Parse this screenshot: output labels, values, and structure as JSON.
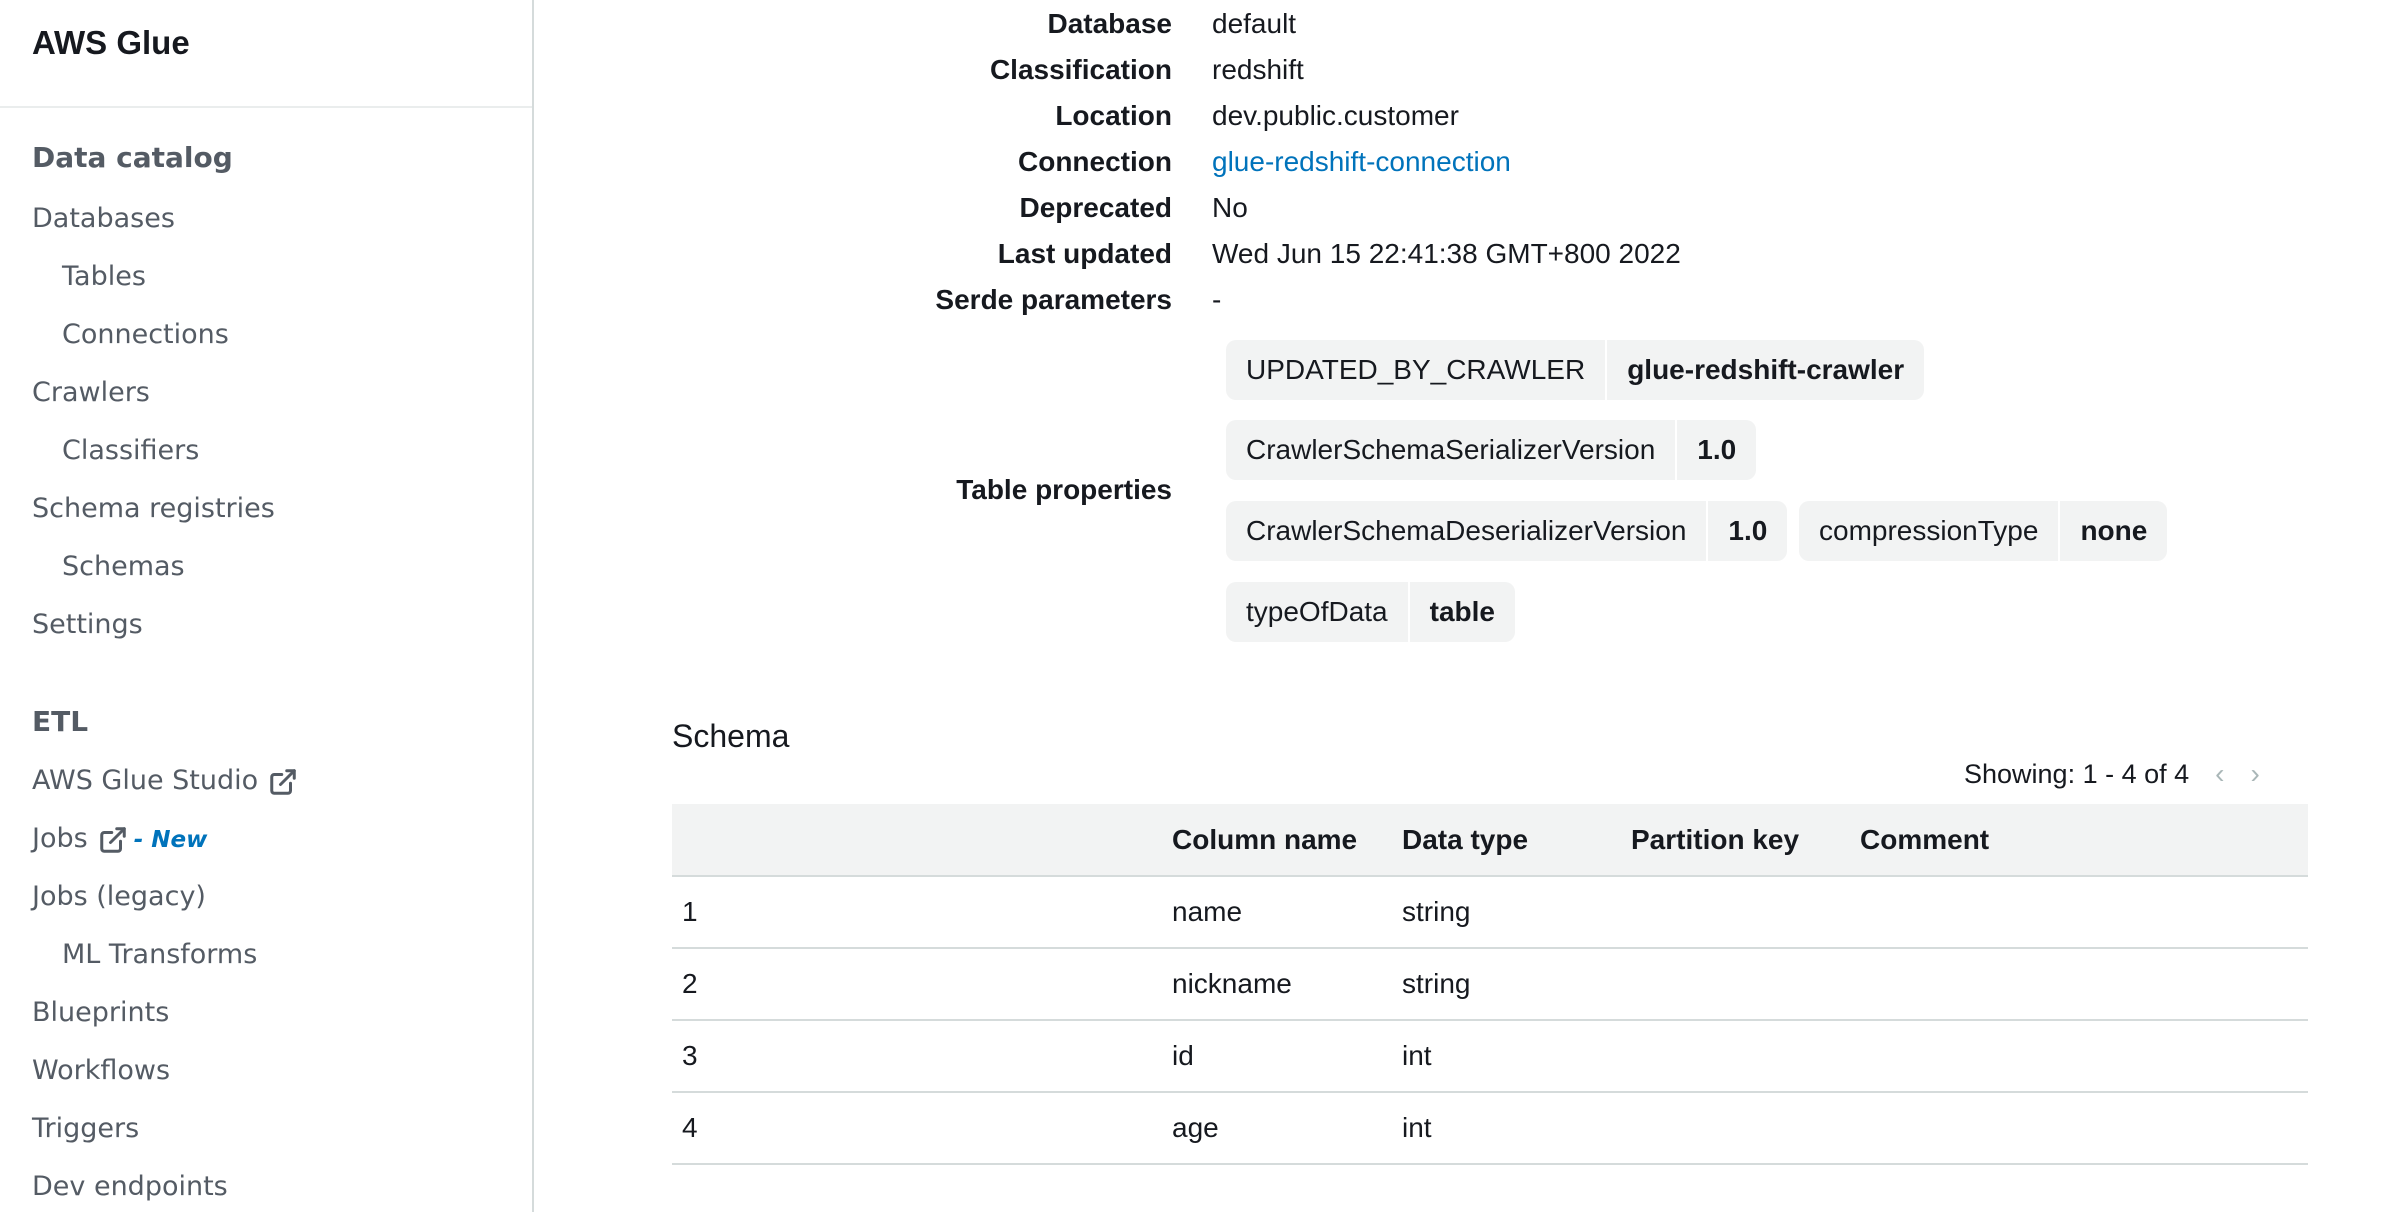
{
  "app": {
    "title": "AWS Glue"
  },
  "sidebar": {
    "sections": [
      {
        "label": "Data catalog"
      },
      {
        "label": "ETL"
      }
    ],
    "items": [
      {
        "label": "Databases"
      },
      {
        "label": "Tables"
      },
      {
        "label": "Connections"
      },
      {
        "label": "Crawlers"
      },
      {
        "label": "Classifiers"
      },
      {
        "label": "Schema registries"
      },
      {
        "label": "Schemas"
      },
      {
        "label": "Settings"
      },
      {
        "label": "AWS Glue Studio",
        "icon": "external-link-icon"
      },
      {
        "label": "Jobs",
        "icon": "external-link-icon",
        "badge": "- New"
      },
      {
        "label": "Jobs (legacy)"
      },
      {
        "label": "ML Transforms"
      },
      {
        "label": "Blueprints"
      },
      {
        "label": "Workflows"
      },
      {
        "label": "Triggers"
      },
      {
        "label": "Dev endpoints"
      }
    ]
  },
  "details": {
    "database": {
      "label": "Database",
      "value": "default"
    },
    "classification": {
      "label": "Classification",
      "value": "redshift"
    },
    "location": {
      "label": "Location",
      "value": "dev.public.customer"
    },
    "connection": {
      "label": "Connection",
      "value": "glue-redshift-connection"
    },
    "deprecated": {
      "label": "Deprecated",
      "value": "No"
    },
    "last_updated": {
      "label": "Last updated",
      "value": "Wed Jun 15 22:41:38 GMT+800 2022"
    },
    "serde": {
      "label": "Serde parameters",
      "value": "-"
    },
    "table_properties": {
      "label": "Table properties",
      "props": [
        {
          "key": "UPDATED_BY_CRAWLER",
          "value": "glue-redshift-crawler"
        },
        {
          "key": "CrawlerSchemaSerializerVersion",
          "value": "1.0"
        },
        {
          "key": "CrawlerSchemaDeserializerVersion",
          "value": "1.0"
        },
        {
          "key": "compressionType",
          "value": "none"
        },
        {
          "key": "typeOfData",
          "value": "table"
        }
      ]
    }
  },
  "schema": {
    "title": "Schema",
    "pager": "Showing: 1 - 4 of 4",
    "columns": [
      "",
      "Column name",
      "Data type",
      "Partition key",
      "Comment"
    ],
    "rows": [
      {
        "idx": "1",
        "name": "name",
        "type": "string",
        "partition": "",
        "comment": ""
      },
      {
        "idx": "2",
        "name": "nickname",
        "type": "string",
        "partition": "",
        "comment": ""
      },
      {
        "idx": "3",
        "name": "id",
        "type": "int",
        "partition": "",
        "comment": ""
      },
      {
        "idx": "4",
        "name": "age",
        "type": "int",
        "partition": "",
        "comment": ""
      }
    ]
  },
  "colors": {
    "link": "#0073bb",
    "chip_bg": "#f2f3f3",
    "nav_text": "#545b64"
  }
}
